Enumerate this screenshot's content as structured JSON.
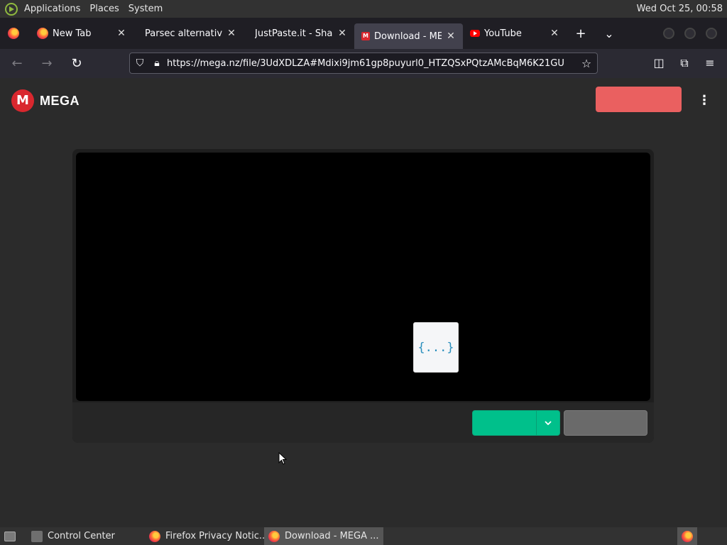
{
  "system_panel": {
    "menus": [
      "Applications",
      "Places",
      "System"
    ],
    "clock": "Wed Oct 25, 00:58"
  },
  "tabs": [
    {
      "title": "New Tab",
      "icon": "firefox-icon",
      "active": false
    },
    {
      "title": "Parsec alternative fo",
      "icon": "none",
      "active": false
    },
    {
      "title": "JustPaste.it - Share",
      "icon": "none",
      "active": false
    },
    {
      "title": "Download - MEG",
      "icon": "mega-icon",
      "active": true
    },
    {
      "title": "YouTube",
      "icon": "youtube-icon",
      "active": false
    }
  ],
  "tab_tools": {
    "new_tab": "+",
    "list_tabs": "⌄"
  },
  "navbar": {
    "url": "https://mega.nz/file/3UdXDLZA#Mdixi9jm61gp8puyurl0_HTZQSxPQtzAMcBqM6K21GU"
  },
  "page": {
    "logo_letter": "M",
    "logo_text": "MEGA",
    "file_glyph": "{...}",
    "colors": {
      "brand_red": "#d9272e",
      "signup": "#f46363",
      "download": "#00c08b",
      "import": "#6a6a6a"
    }
  },
  "taskbar": {
    "items": [
      {
        "label": "Control Center",
        "active": false
      },
      {
        "label": "Firefox Privacy Notic...",
        "active": false
      },
      {
        "label": "Download - MEGA ...",
        "active": true
      }
    ]
  }
}
